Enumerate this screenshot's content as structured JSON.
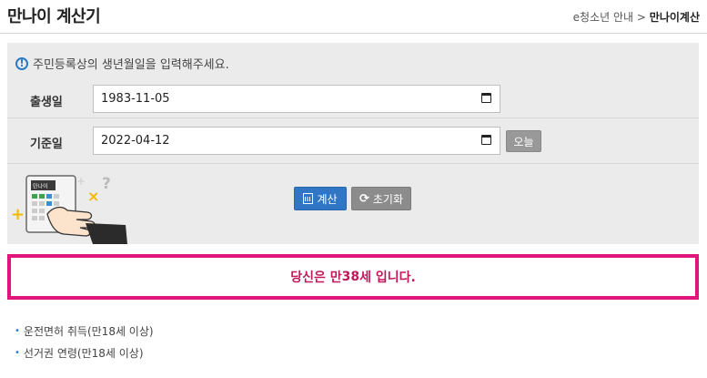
{
  "header": {
    "title": "만나이 계산기",
    "breadcrumb_parent": "e청소년 안내",
    "breadcrumb_sep": ">",
    "breadcrumb_current": "만나이계산"
  },
  "form": {
    "notice": "주민등록상의 생년월일을 입력해주세요.",
    "birth_label": "출생일",
    "birth_value": "1983-11-05",
    "base_label": "기준일",
    "base_value": "2022-04-12",
    "today_button": "오늘",
    "calc_button": "계산",
    "reset_button": "초기화",
    "illustration_screen_text": "만나이"
  },
  "result": {
    "prefix": "당신은 만 ",
    "age": "38",
    "suffix": "세 입니다."
  },
  "info_list": [
    {
      "text": "운전면허 취득(만18세 이상)"
    },
    {
      "text": "선거권 연령(만18세 이상)"
    }
  ],
  "colors": {
    "accent_blue": "#3176c4",
    "result_border": "#e0147c",
    "result_text": "#c2185b",
    "panel_bg": "#ebebeb"
  },
  "icons": [
    "info-icon",
    "calendar-icon",
    "calculator-icon",
    "refresh-icon"
  ]
}
